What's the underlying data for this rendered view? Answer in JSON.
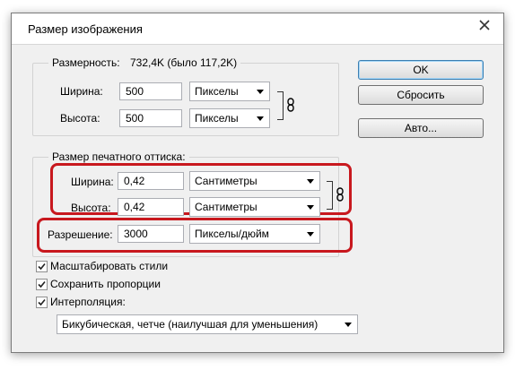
{
  "window": {
    "title": "Размер изображения"
  },
  "dimensions": {
    "label": "Размерность:",
    "value": "732,4K (было 117,2K)",
    "width_label": "Ширина:",
    "width_value": "500",
    "width_unit": "Пикселы",
    "height_label": "Высота:",
    "height_value": "500",
    "height_unit": "Пикселы"
  },
  "print_size": {
    "label": "Размер печатного оттиска:",
    "width_label": "Ширина:",
    "width_value": "0,42",
    "width_unit": "Сантиметры",
    "height_label": "Высота:",
    "height_value": "0,42",
    "height_unit": "Сантиметры",
    "resolution_label": "Разрешение:",
    "resolution_value": "3000",
    "resolution_unit": "Пикселы/дюйм"
  },
  "buttons": {
    "ok": "OK",
    "reset": "Сбросить",
    "auto": "Авто..."
  },
  "options": {
    "scale_styles": {
      "label": "Масштабировать стили",
      "checked": true
    },
    "constrain": {
      "label": "Сохранить пропорции",
      "checked": true
    },
    "resample": {
      "label": "Интерполяция:",
      "checked": true
    },
    "resample_method": "Бикубическая, четче (наилучшая для уменьшения)"
  },
  "colors": {
    "highlight": "#c8181e",
    "default_button_border": "#3c7fb1"
  },
  "icons": {
    "close": "close-icon",
    "link": "chain-link-icon",
    "check": "checkmark-icon"
  }
}
